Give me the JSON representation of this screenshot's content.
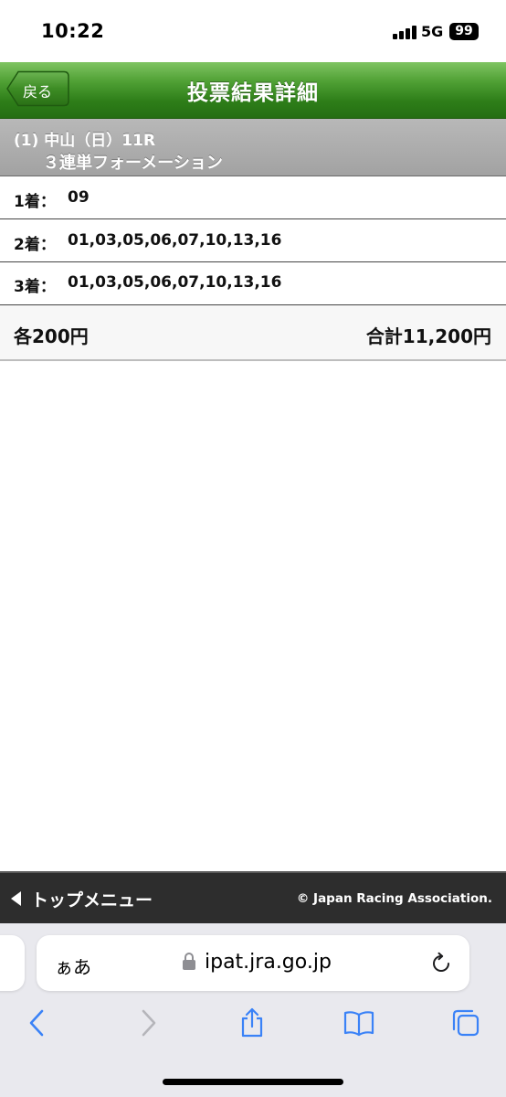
{
  "status_bar": {
    "time": "10:22",
    "network": "5G",
    "battery": "99"
  },
  "header": {
    "back_label": "戻る",
    "title": "投票結果詳細"
  },
  "race": {
    "line1": "(1) 中山（日）11R",
    "line2": "３連単フォーメーション"
  },
  "rows": [
    {
      "label": "1着：",
      "value": "09"
    },
    {
      "label": "2着：",
      "value": "01,03,05,06,07,10,13,16"
    },
    {
      "label": "3着：",
      "value": "01,03,05,06,07,10,13,16"
    }
  ],
  "summary": {
    "each": "各200円",
    "total": "合計11,200円"
  },
  "footer": {
    "top_menu": "トップメニュー",
    "copyright": "© Japan Racing Association."
  },
  "browser": {
    "aa_label": "ぁあ",
    "url": "ipat.jra.go.jp"
  },
  "colors": {
    "header_green": "#2e7e19",
    "safari_blue": "#3a82f7"
  }
}
